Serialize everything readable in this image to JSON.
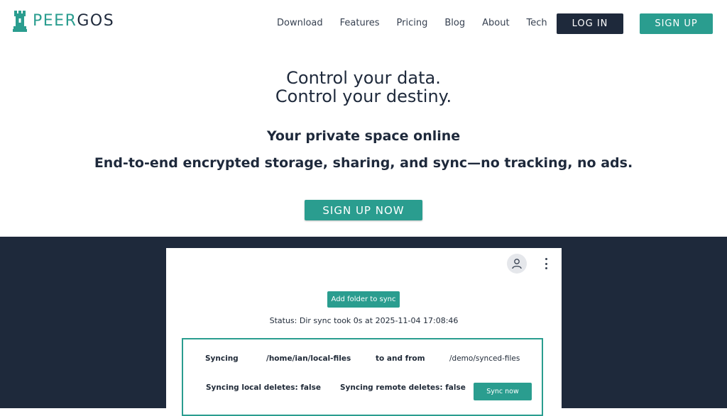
{
  "brand": {
    "logo_peer": "PEER",
    "logo_gos": "GOS",
    "primary_color": "#2a9d8f",
    "dark_color": "#1e293b"
  },
  "nav": {
    "links": [
      "Download",
      "Features",
      "Pricing",
      "Blog",
      "About",
      "Tech"
    ],
    "login_label": "LOG IN",
    "signup_label": "SIGN UP"
  },
  "hero": {
    "headline_line1": "Control your data.",
    "headline_line2": "Control your destiny.",
    "subtitle1": "Your private space online",
    "subtitle2": "End-to-end encrypted storage, sharing, and sync—no tracking, no ads.",
    "cta_label": "SIGN UP NOW"
  },
  "app": {
    "user_icon": "user-icon",
    "menu_icon": "kebab-menu-icon",
    "add_folder_label": "Add folder to sync",
    "status_text": "Status: Dir sync took 0s at 2025-11-04 17:08:46",
    "sync": {
      "syncing_label": "Syncing",
      "local_path": "/home/ian/local-files",
      "to_and_from": "to and from",
      "remote_path": "/demo/synced-files",
      "local_deletes": "Syncing local deletes: false",
      "remote_deletes": "Syncing remote deletes: false",
      "sync_now_label": "Sync now"
    }
  }
}
